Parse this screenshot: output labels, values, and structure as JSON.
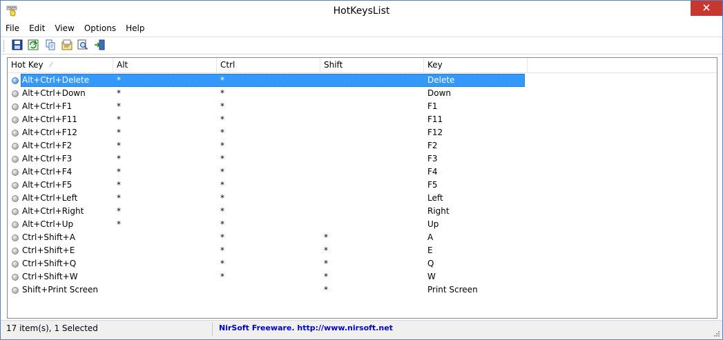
{
  "window": {
    "title": "HotKeysList"
  },
  "menu": {
    "items": [
      "File",
      "Edit",
      "View",
      "Options",
      "Help"
    ]
  },
  "toolbar": {
    "buttons": [
      "save-icon",
      "refresh-icon",
      "copy-icon",
      "properties-icon",
      "find-icon",
      "exit-icon"
    ]
  },
  "table": {
    "columns": [
      "Hot Key",
      "Alt",
      "Ctrl",
      "Shift",
      "Key"
    ],
    "rows": [
      [
        "Alt+Ctrl+Delete",
        "*",
        "*",
        "",
        "Delete"
      ],
      [
        "Alt+Ctrl+Down",
        "*",
        "*",
        "",
        "Down"
      ],
      [
        "Alt+Ctrl+F1",
        "*",
        "*",
        "",
        "F1"
      ],
      [
        "Alt+Ctrl+F11",
        "*",
        "*",
        "",
        "F11"
      ],
      [
        "Alt+Ctrl+F12",
        "*",
        "*",
        "",
        "F12"
      ],
      [
        "Alt+Ctrl+F2",
        "*",
        "*",
        "",
        "F2"
      ],
      [
        "Alt+Ctrl+F3",
        "*",
        "*",
        "",
        "F3"
      ],
      [
        "Alt+Ctrl+F4",
        "*",
        "*",
        "",
        "F4"
      ],
      [
        "Alt+Ctrl+F5",
        "*",
        "*",
        "",
        "F5"
      ],
      [
        "Alt+Ctrl+Left",
        "*",
        "*",
        "",
        "Left"
      ],
      [
        "Alt+Ctrl+Right",
        "*",
        "*",
        "",
        "Right"
      ],
      [
        "Alt+Ctrl+Up",
        "*",
        "*",
        "",
        "Up"
      ],
      [
        "Ctrl+Shift+A",
        "",
        "*",
        "*",
        "A"
      ],
      [
        "Ctrl+Shift+E",
        "",
        "*",
        "*",
        "E"
      ],
      [
        "Ctrl+Shift+Q",
        "",
        "*",
        "*",
        "Q"
      ],
      [
        "Ctrl+Shift+W",
        "",
        "*",
        "*",
        "W"
      ],
      [
        "Shift+Print Screen",
        "",
        "",
        "*",
        "Print Screen"
      ]
    ],
    "selected_index": 0
  },
  "status": {
    "items": "17 item(s), 1 Selected",
    "link": "NirSoft Freeware.  http://www.nirsoft.net"
  },
  "colors": {
    "selection": "#3399ff",
    "close": "#c7372f",
    "link": "#0000cc"
  }
}
